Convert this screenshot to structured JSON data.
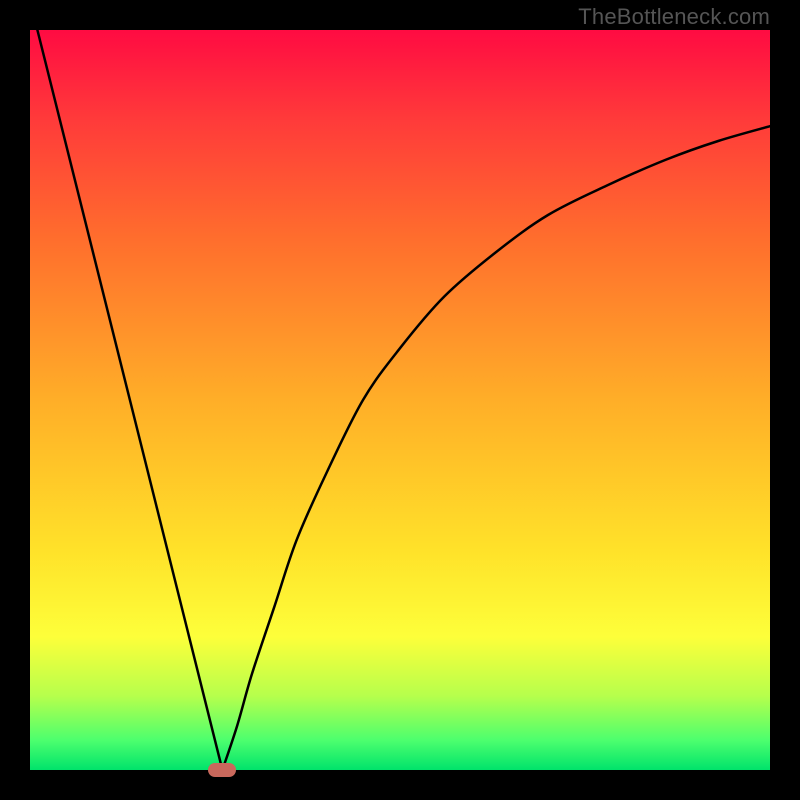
{
  "watermark": "TheBottleneck.com",
  "chart_data": {
    "type": "line",
    "title": "",
    "xlabel": "",
    "ylabel": "",
    "x_range": [
      0,
      100
    ],
    "y_range": [
      0,
      100
    ],
    "series": [
      {
        "name": "left-line",
        "x": [
          1,
          26
        ],
        "y": [
          100,
          0
        ]
      },
      {
        "name": "right-curve",
        "x": [
          26,
          28,
          30,
          33,
          36,
          40,
          45,
          50,
          56,
          63,
          70,
          78,
          86,
          93,
          100
        ],
        "y": [
          0,
          6,
          13,
          22,
          31,
          40,
          50,
          57,
          64,
          70,
          75,
          79,
          82.5,
          85,
          87
        ]
      }
    ],
    "marker": {
      "x": 26,
      "y": 0,
      "color": "#c8685c"
    },
    "gradient_stops": [
      {
        "pos": 0,
        "color": "#ff0b42"
      },
      {
        "pos": 12,
        "color": "#ff3a3a"
      },
      {
        "pos": 28,
        "color": "#ff6d2d"
      },
      {
        "pos": 50,
        "color": "#ffae28"
      },
      {
        "pos": 70,
        "color": "#ffe129"
      },
      {
        "pos": 82,
        "color": "#fdff3a"
      },
      {
        "pos": 90,
        "color": "#b6ff4c"
      },
      {
        "pos": 96,
        "color": "#4cff6e"
      },
      {
        "pos": 100,
        "color": "#00e36b"
      }
    ]
  }
}
